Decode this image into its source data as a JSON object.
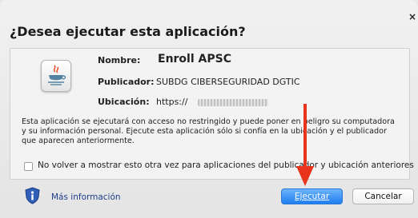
{
  "dialog": {
    "title": "¿Desea ejecutar esta aplicación?",
    "close_glyph": "×"
  },
  "app_info": {
    "name_label": "Nombre:",
    "name_value": "Enroll APSC",
    "publisher_label": "Publicador:",
    "publisher_value": "SUBDG CIBERSEGURIDAD DGTIC",
    "location_label": "Ubicación:",
    "location_value": "https://"
  },
  "warning_text": "Esta aplicación se ejecutará con acceso no restringido y puede poner en peligro su computadora y su información personal. Ejecute esta aplicación sólo si confía en la ubicación y el publicador que aparecen anteriormente.",
  "checkbox": {
    "label": "No volver a mostrar esto otra vez para aplicaciones del publicador y ubicación anteriores",
    "checked": false
  },
  "footer": {
    "more_info_label": "Más información",
    "run_button": "Ejecutar",
    "cancel_button": "Cancelar"
  },
  "icons": {
    "app": "java-icon",
    "info": "shield-info-icon",
    "annotation": "red-arrow-icon"
  },
  "colors": {
    "primary_button": "#1f7ef0",
    "link": "#1e3f8c",
    "annotation_arrow": "#e8341c"
  }
}
